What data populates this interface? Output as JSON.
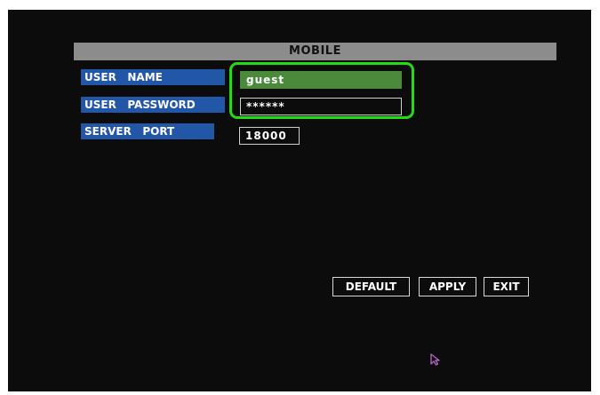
{
  "title": "MOBILE",
  "fields": {
    "user_name": {
      "label": "USER   NAME",
      "value": "guest"
    },
    "user_password": {
      "label": "USER   PASSWORD",
      "value": "******"
    },
    "server_port": {
      "label": "SERVER   PORT",
      "value": "18000"
    }
  },
  "buttons": {
    "default": "DEFAULT",
    "apply": "APPLY",
    "exit": "EXIT"
  },
  "colors": {
    "title_bar": "#8c8c8c",
    "label_bg": "#2257a8",
    "selected_field": "#4b8a3a",
    "highlight_ring": "#22dd11"
  },
  "icons": {
    "cursor": "mouse-pointer-icon"
  }
}
